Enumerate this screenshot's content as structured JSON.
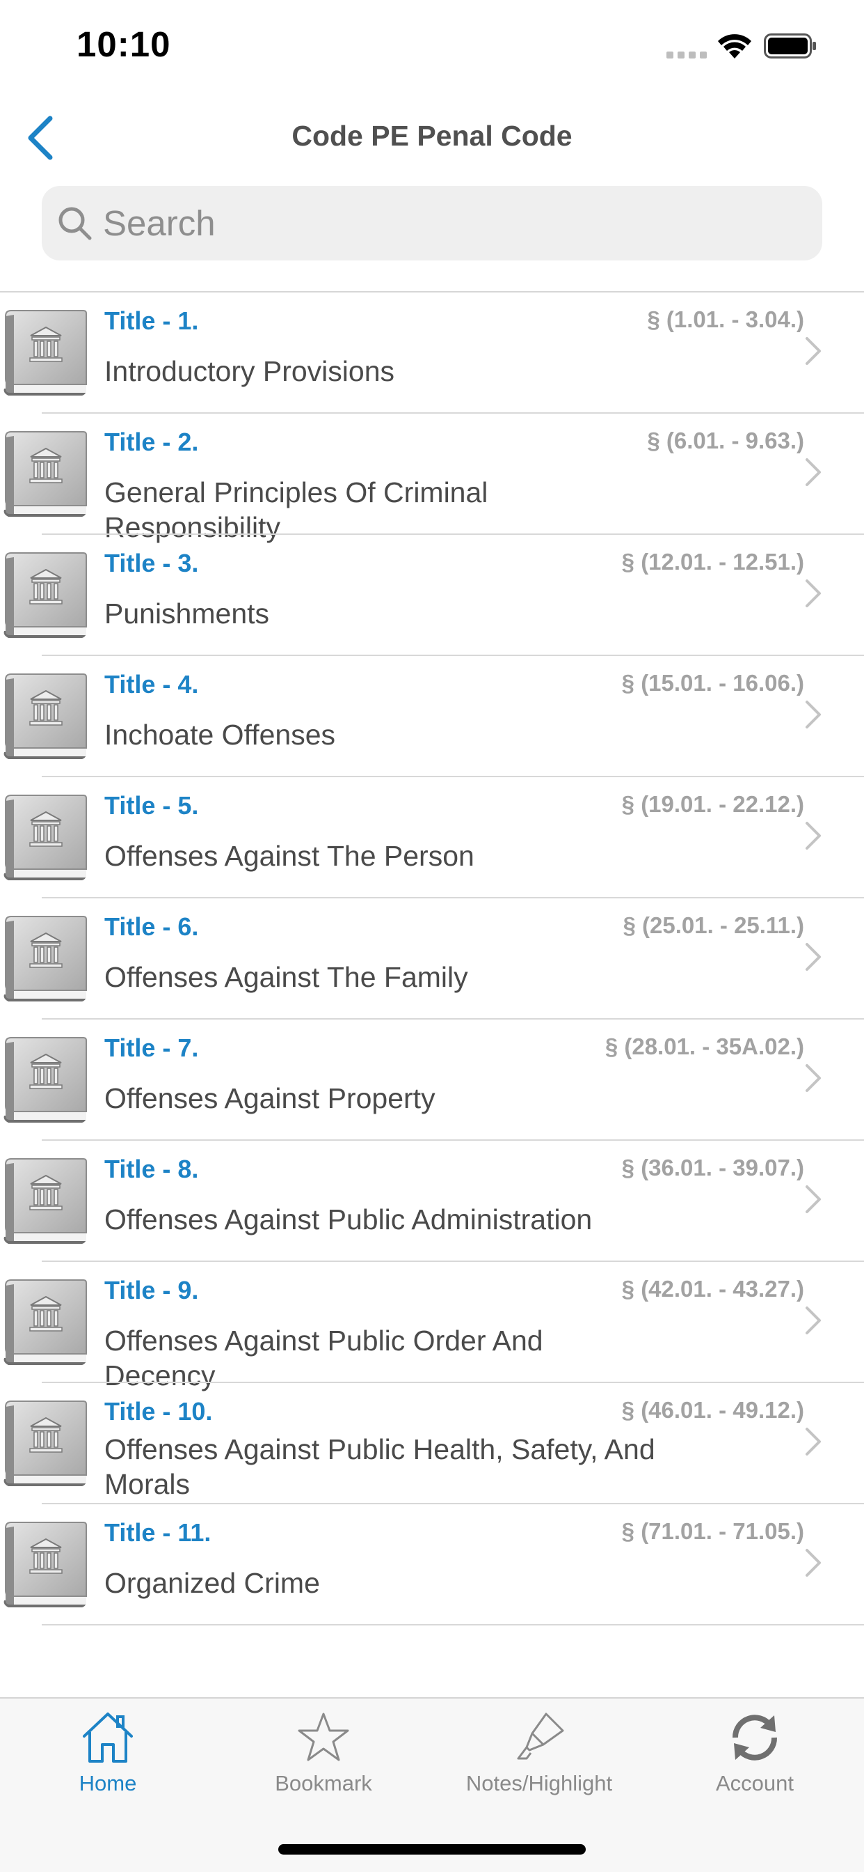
{
  "status_bar": {
    "time": "10:10"
  },
  "nav": {
    "title": "Code PE Penal Code"
  },
  "search": {
    "placeholder": "Search"
  },
  "titles": [
    {
      "label": "Title - 1.",
      "range": "§ (1.01. - 3.04.)",
      "desc": "Introductory Provisions"
    },
    {
      "label": "Title - 2.",
      "range": "§ (6.01. - 9.63.)",
      "desc": "General Principles Of Criminal Responsibility"
    },
    {
      "label": "Title - 3.",
      "range": "§ (12.01. - 12.51.)",
      "desc": "Punishments"
    },
    {
      "label": "Title - 4.",
      "range": "§ (15.01. - 16.06.)",
      "desc": "Inchoate Offenses"
    },
    {
      "label": "Title - 5.",
      "range": "§ (19.01. - 22.12.)",
      "desc": "Offenses Against The Person"
    },
    {
      "label": "Title - 6.",
      "range": "§ (25.01. - 25.11.)",
      "desc": "Offenses Against The Family"
    },
    {
      "label": "Title - 7.",
      "range": "§ (28.01. - 35A.02.)",
      "desc": "Offenses Against Property"
    },
    {
      "label": "Title - 8.",
      "range": "§ (36.01. - 39.07.)",
      "desc": "Offenses Against Public Administration"
    },
    {
      "label": "Title - 9.",
      "range": "§ (42.01. - 43.27.)",
      "desc": "Offenses Against Public Order And Decency"
    },
    {
      "label": "Title - 10.",
      "range": "§ (46.01. - 49.12.)",
      "desc": "Offenses Against Public Health, Safety, And Morals"
    },
    {
      "label": "Title - 11.",
      "range": "§ (71.01. - 71.05.)",
      "desc": "Organized Crime"
    }
  ],
  "tabs": [
    {
      "label": "Home",
      "icon": "home-icon",
      "active": true
    },
    {
      "label": "Bookmark",
      "icon": "star-icon",
      "active": false
    },
    {
      "label": "Notes/Highlight",
      "icon": "highlighter-icon",
      "active": false
    },
    {
      "label": "Account",
      "icon": "sync-icon",
      "active": false
    }
  ],
  "colors": {
    "accent": "#1d83c6",
    "range": "#a2a2a2",
    "text": "#4a4a4a"
  }
}
